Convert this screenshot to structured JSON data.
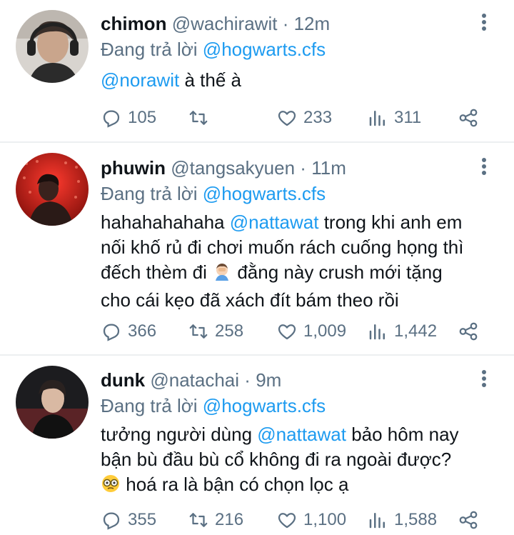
{
  "tweets": [
    {
      "name": "chimon",
      "handle": "@wachirawit",
      "dot": "·",
      "time": "12m",
      "reply_prefix": "Đang trả lời",
      "reply_to": "@hogwarts.cfs",
      "mention": "@norawit",
      "text": "à thế à",
      "replies": "105",
      "retweets": "",
      "likes": "233",
      "views": "311"
    },
    {
      "name": "phuwin",
      "handle": "@tangsakyuen",
      "dot": "·",
      "time": "11m",
      "reply_prefix": "Đang trả lời",
      "reply_to": "@hogwarts.cfs",
      "text_before": "hahahahahaha",
      "mention": "@nattawat",
      "text_line1_after": "trong khi anh em",
      "text_line2": "nối khố rủ đi chơi muốn rách cuống họng thì",
      "text_line3_before": "đếch thèm đi",
      "emoji_name": "person-facepalming-emoji",
      "text_line3_after": "đằng này crush mới tặng",
      "text_line4": "cho cái kẹo đã xách đít bám theo rồi",
      "replies": "366",
      "retweets": "258",
      "likes": "1,009",
      "views": "1,442"
    },
    {
      "name": "dunk",
      "handle": "@natachai",
      "dot": "·",
      "time": "9m",
      "reply_prefix": "Đang trả lời",
      "reply_to": "@hogwarts.cfs",
      "text_line1_before": "tưởng người dùng",
      "mention": "@nattawat",
      "text_line1_after": "bảo hôm nay",
      "text_line2": "bận bù đầu bù cổ không đi ra ngoài được?",
      "emoji_name": "face-with-monocle-glasses-emoji",
      "text_line3": "hoá ra là bận có chọn lọc ạ",
      "replies": "355",
      "retweets": "216",
      "likes": "1,100",
      "views": "1,588"
    }
  ],
  "colors": {
    "link": "#1d9bf0",
    "muted": "#5b7083",
    "text": "#0f1419",
    "divider": "#eceff1"
  }
}
